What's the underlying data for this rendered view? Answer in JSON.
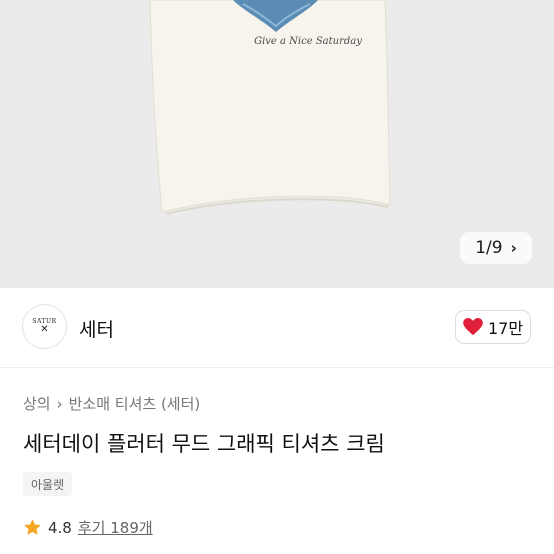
{
  "gallery": {
    "current": "1",
    "separator": "/",
    "total": "9",
    "next_icon": "chevron-right-icon",
    "shirt_print_text": "Give a Nice Saturday",
    "background": "#ebebeb"
  },
  "brand": {
    "logo_text": "SATUR",
    "logo_mark": "✕",
    "name": "세터",
    "like_icon": "heart-icon",
    "like_color": "#e0203a",
    "like_count": "17만"
  },
  "breadcrumb": {
    "category": "상의",
    "subcategory": "반소매 티셔츠 (세터)",
    "sep_icon": "chevron-right-icon"
  },
  "product": {
    "title": "세터데이 플러터 무드 그래픽 티셔츠 크림",
    "tag": "아울렛",
    "rating_icon": "star-icon",
    "star_color": "#f5a623",
    "rating": "4.8",
    "reviews": "후기 189개"
  }
}
